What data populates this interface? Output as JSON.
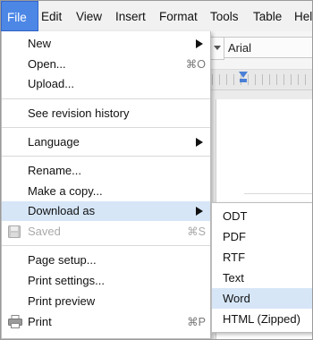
{
  "menubar": {
    "items": [
      "File",
      "Edit",
      "View",
      "Insert",
      "Format",
      "Tools",
      "Table",
      "Hel"
    ],
    "active": "File"
  },
  "toolbar": {
    "font": "Arial"
  },
  "file_menu": {
    "items": [
      {
        "label": "New",
        "submenu": true
      },
      {
        "label": "Open...",
        "shortcut": "⌘O"
      },
      {
        "label": "Upload..."
      },
      {
        "label": "See revision history"
      },
      {
        "label": "Language",
        "submenu": true
      },
      {
        "label": "Rename..."
      },
      {
        "label": "Make a copy..."
      },
      {
        "label": "Download as",
        "submenu": true,
        "highlighted": true
      },
      {
        "label": "Saved",
        "shortcut": "⌘S",
        "disabled": true,
        "icon": "floppy-disk-icon"
      },
      {
        "label": "Page setup..."
      },
      {
        "label": "Print settings..."
      },
      {
        "label": "Print preview"
      },
      {
        "label": "Print",
        "shortcut": "⌘P",
        "icon": "printer-icon"
      }
    ]
  },
  "download_submenu": {
    "items": [
      "ODT",
      "PDF",
      "RTF",
      "Text",
      "Word",
      "HTML (Zipped)"
    ],
    "highlighted": "Word"
  },
  "colors": {
    "active_menu": "#4d87e6",
    "highlight": "#d6e6f7"
  }
}
